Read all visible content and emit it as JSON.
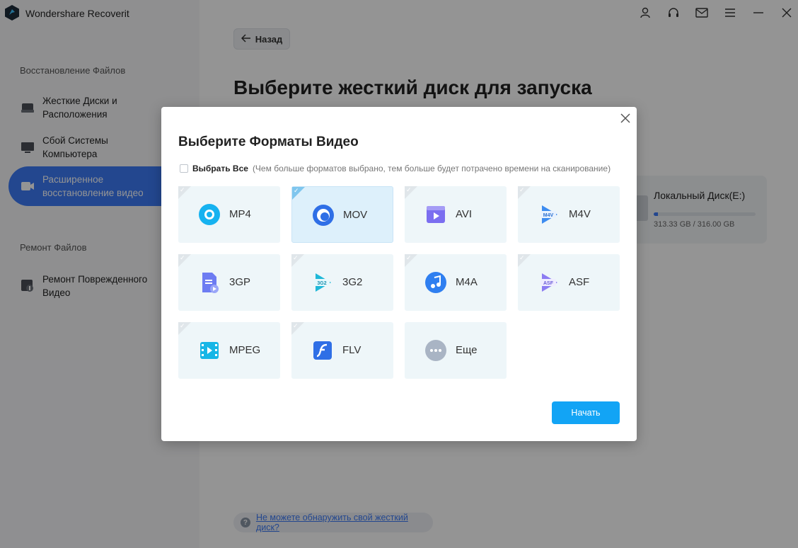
{
  "app": {
    "title": "Wondershare Recoverit"
  },
  "sidebar": {
    "section1_label": "Восстановление Файлов",
    "section2_label": "Ремонт Файлов",
    "items": [
      {
        "label": "Жесткие Диски и\nРасположения",
        "icon": "hard-drive-icon",
        "active": false
      },
      {
        "label": "Сбой Системы\nКомпьютера",
        "icon": "computer-icon",
        "active": false
      },
      {
        "label": "Расширенное\nвосстановление видео",
        "icon": "video-camera-icon",
        "active": true
      },
      {
        "label": "Ремонт Поврежденного\nВидео",
        "icon": "video-repair-icon",
        "active": false
      }
    ]
  },
  "topbar": {
    "icons": [
      "user-icon",
      "support-headset-icon",
      "mail-icon",
      "menu-icon",
      "minimize-icon",
      "close-icon"
    ]
  },
  "main": {
    "back_label": "Назад",
    "title": "Выберите жесткий диск для запуска\nвосстановления видео:",
    "disk": {
      "name": "Локальный Диск(E:)",
      "size": "313.33 GB / 316.00 GB",
      "used_fraction": 0.04
    },
    "help_link": "Не можете обнаружить свой жесткий диск?"
  },
  "modal": {
    "title": "Выберите Форматы Видео",
    "select_all_label": "Выбрать Все",
    "select_all_note": "(Чем больше форматов выбрано, тем больше будет потрачено времени на сканирование)",
    "start_label": "Начать",
    "formats": [
      {
        "label": "MP4",
        "icon": "mp4-icon",
        "selected": false
      },
      {
        "label": "MOV",
        "icon": "mov-icon",
        "selected": true
      },
      {
        "label": "AVI",
        "icon": "avi-icon",
        "selected": false
      },
      {
        "label": "M4V",
        "icon": "m4v-icon",
        "selected": false
      },
      {
        "label": "3GP",
        "icon": "3gp-icon",
        "selected": false
      },
      {
        "label": "3G2",
        "icon": "3g2-icon",
        "selected": false
      },
      {
        "label": "M4A",
        "icon": "m4a-icon",
        "selected": false
      },
      {
        "label": "ASF",
        "icon": "asf-icon",
        "selected": false
      },
      {
        "label": "MPEG",
        "icon": "mpeg-icon",
        "selected": false
      },
      {
        "label": "FLV",
        "icon": "flv-icon",
        "selected": false
      },
      {
        "label": "Еще",
        "icon": "more-icon",
        "selected": false
      }
    ]
  },
  "colors": {
    "accent": "#3d7bf7",
    "button": "#12a4f5",
    "tile": "#eef6f9",
    "tile_selected": "#ddf0fb"
  }
}
